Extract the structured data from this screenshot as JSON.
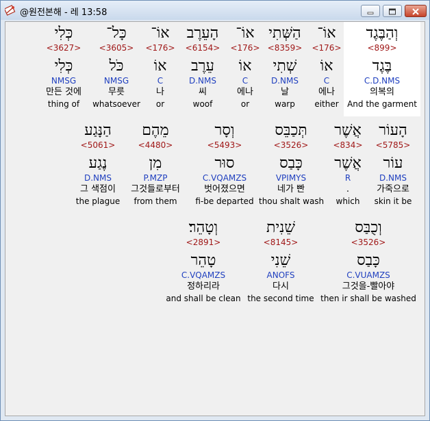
{
  "window": {
    "title": "@원전본해 - 레 13:58",
    "icon": "app-book-icon",
    "buttons": [
      "minimize-icon",
      "maximize-icon",
      "close-icon"
    ]
  },
  "rows": [
    {
      "words": [
        {
          "heb": "כְּלִי",
          "num": "<3627>",
          "root": "כְּלִי",
          "morph": "NMSG",
          "kor": "만든 것에",
          "eng": "thing of"
        },
        {
          "heb": "כָּל־",
          "num": "<3605>",
          "root": "כֹּל",
          "morph": "NMSG",
          "kor": "무릇",
          "eng": "whatsoever"
        },
        {
          "heb": "אוֹ־",
          "num": "<176>",
          "root": "אוֹ",
          "morph": "C",
          "kor": "나",
          "eng": "or"
        },
        {
          "heb": "הָעֵרֶב",
          "num": "<6154>",
          "root": "עֵרֶב",
          "morph": "D.NMS",
          "kor": "씨",
          "eng": "woof"
        },
        {
          "heb": "אוֹ־",
          "num": "<176>",
          "root": "אוֹ",
          "morph": "C",
          "kor": "에나",
          "eng": "or"
        },
        {
          "heb": "הַשְּׁתִי",
          "num": "<8359>",
          "root": "שְׁתִי",
          "morph": "D.NMS",
          "kor": "날",
          "eng": "warp"
        },
        {
          "heb": "אוֹ־",
          "num": "<176>",
          "root": "אוֹ",
          "morph": "C",
          "kor": "에나",
          "eng": "either"
        },
        {
          "heb": "וְהַבֶּגֶד",
          "num": "<899>",
          "root": "בֶּגֶד",
          "morph": "C.D.NMS",
          "kor": "의복의",
          "eng": "And the garment",
          "selected": true
        }
      ]
    },
    {
      "words": [
        {
          "heb": "הַנָּגַע",
          "num": "<5061>",
          "root": "נֶגַע",
          "morph": "D.NMS",
          "kor": "그 색점이",
          "eng": "the plague"
        },
        {
          "heb": "מֵהֶם",
          "num": "<4480>",
          "root": "מִן",
          "morph": "P.MZP",
          "kor": "그것들로부터",
          "eng": "from them"
        },
        {
          "heb": "וְסָר",
          "num": "<5493>",
          "root": "סוּר",
          "morph": "C.VQAMZS",
          "kor": "벗어졌으면",
          "eng": "fi-be departed"
        },
        {
          "heb": "תְּכַבֵּס",
          "num": "<3526>",
          "root": "כָּבַס",
          "morph": "VPIMYS",
          "kor": "네가 빤",
          "eng": "thou shalt wash"
        },
        {
          "heb": "אֲשֶׁר",
          "num": "<834>",
          "root": "אֲשֶׁר",
          "morph": "R",
          "kor": ".",
          "eng": "which"
        },
        {
          "heb": "הָעוֹר",
          "num": "<5785>",
          "root": "עוֹר",
          "morph": "D.NMS",
          "kor": "가죽으로",
          "eng": "skin it be"
        }
      ]
    },
    {
      "words": [
        {
          "heb": "וְטָהֵר׃",
          "num": "<2891>",
          "root": "טָהֵר",
          "morph": "C.VQAMZS",
          "kor": "정하리라",
          "eng": "and shall be clean"
        },
        {
          "heb": "שֵׁנִית",
          "num": "<8145>",
          "root": "שֵׁנִי",
          "morph": "ANOFS",
          "kor": "다시",
          "eng": "the second time"
        },
        {
          "heb": "וְכֻבַּס",
          "num": "<3526>",
          "root": "כָּבַס",
          "morph": "C.VUAMZS",
          "kor": "그것을-빨아야",
          "eng": "then ir shall be washed"
        }
      ]
    }
  ]
}
